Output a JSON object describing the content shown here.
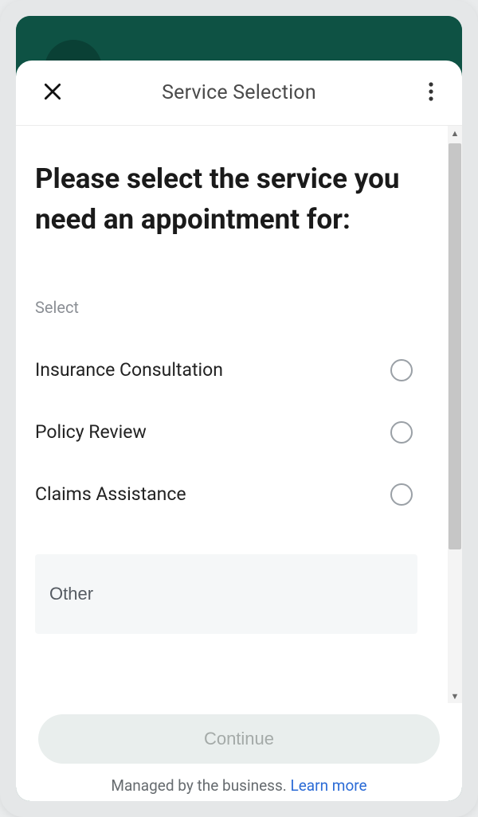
{
  "header": {
    "title": "Service Selection"
  },
  "main": {
    "prompt": "Please select the service you need an appointment for:",
    "section_label": "Select",
    "options": [
      {
        "label": "Insurance Consultation"
      },
      {
        "label": "Policy Review"
      },
      {
        "label": "Claims Assistance"
      }
    ],
    "other_placeholder": "Other"
  },
  "footer": {
    "continue_label": "Continue",
    "managed_text": "Managed by the business. ",
    "learn_more": "Learn more"
  },
  "icons": {
    "close": "close-icon",
    "more": "more-vert-icon"
  }
}
